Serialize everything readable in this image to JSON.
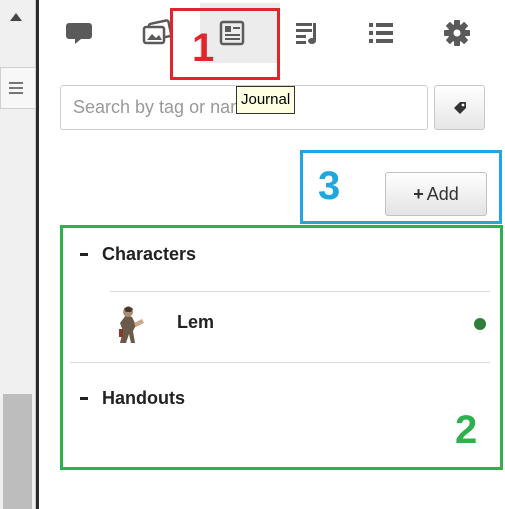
{
  "search": {
    "placeholder": "Search by tag or name..."
  },
  "tooltip": {
    "text": "Journal"
  },
  "tabs": [
    {
      "icon": "chat-icon"
    },
    {
      "icon": "art-library-icon"
    },
    {
      "icon": "journal-icon",
      "active": true
    },
    {
      "icon": "jukebox-icon"
    },
    {
      "icon": "compendium-list-icon"
    },
    {
      "icon": "settings-gear-icon"
    }
  ],
  "add_button": {
    "icon": "+",
    "label": "Add"
  },
  "journal": {
    "folders": [
      {
        "toggle": "-",
        "name": "Characters",
        "entries": [
          {
            "name": "Lem",
            "status_color": "#2f7d3a"
          }
        ]
      },
      {
        "toggle": "-",
        "name": "Handouts",
        "entries": []
      }
    ]
  },
  "annotations": {
    "one": "1",
    "two": "2",
    "three": "3",
    "colors": {
      "one": "#e2242c",
      "two": "#2bb24c",
      "three": "#1ea7e1"
    }
  }
}
